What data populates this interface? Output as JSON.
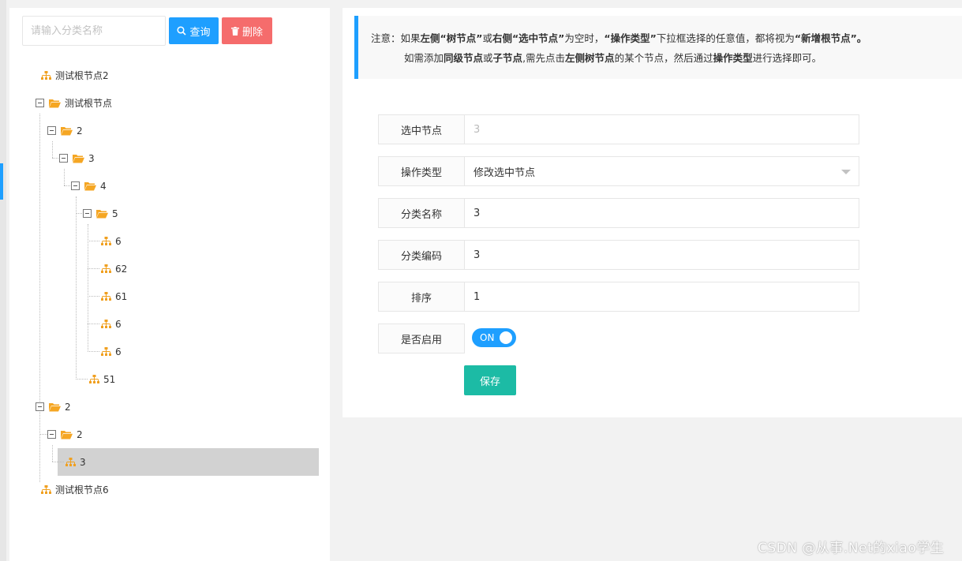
{
  "search": {
    "placeholder": "请输入分类名称",
    "query_label": "查询",
    "delete_label": "删除"
  },
  "tree": [
    {
      "label": "测试根节点2"
    },
    {
      "label": "测试根节点"
    },
    {
      "label": "2"
    },
    {
      "label": "3"
    },
    {
      "label": "4"
    },
    {
      "label": "5"
    },
    {
      "label": "6"
    },
    {
      "label": "62"
    },
    {
      "label": "61"
    },
    {
      "label": "6"
    },
    {
      "label": "6"
    },
    {
      "label": "51"
    },
    {
      "label": "2"
    },
    {
      "label": "2"
    },
    {
      "label": "3"
    },
    {
      "label": "测试根节点6"
    }
  ],
  "notice": {
    "l1_a": "注意：如果",
    "l1_b": "左侧“树节点”",
    "l1_c": "或",
    "l1_d": "右侧“选中节点”",
    "l1_e": "为空时，",
    "l1_f": "“操作类型”",
    "l1_g": "下拉框选择的任意值，都将视为",
    "l1_h": "“新增根节点”。",
    "l2_a": "如需添加",
    "l2_b": "同级节点",
    "l2_c": "或",
    "l2_d": "子节点",
    "l2_e": ",需先点击",
    "l2_f": "左侧树节点",
    "l2_g": "的某个节点，然后通过",
    "l2_h": "操作类型",
    "l2_i": "进行选择即可。"
  },
  "form": {
    "selected_node": {
      "label": "选中节点",
      "value": "3"
    },
    "op_type": {
      "label": "操作类型",
      "value": "修改选中节点"
    },
    "cat_name": {
      "label": "分类名称",
      "value": "3"
    },
    "cat_code": {
      "label": "分类编码",
      "value": "3"
    },
    "sort": {
      "label": "排序",
      "value": "1"
    },
    "enabled": {
      "label": "是否启用",
      "value": "ON"
    },
    "save_label": "保存"
  },
  "watermark": "CSDN @从事.Net的xiao学生",
  "colors": {
    "primary": "#1e9fff",
    "danger": "#f56c6c",
    "save": "#1cbba5",
    "folder": "#f5a623",
    "leaf": "#f0a020"
  }
}
